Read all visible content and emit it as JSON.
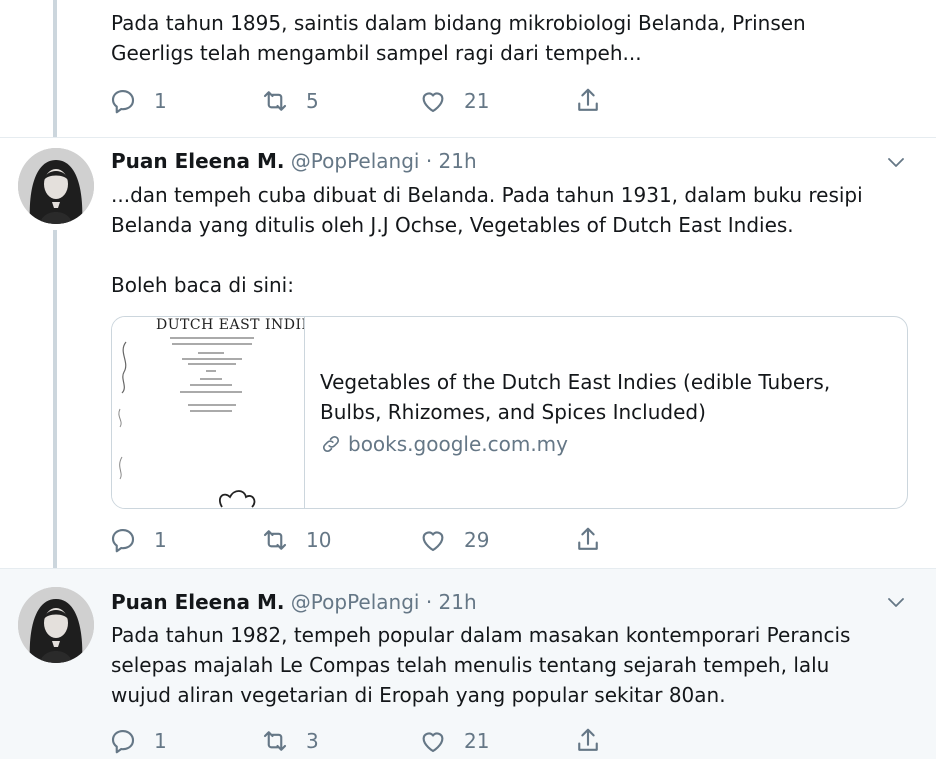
{
  "tweet_top": {
    "text": "Pada tahun 1895, saintis dalam bidang mikrobiologi Belanda, Prinsen\nGeerligs telah mengambil sampel ragi dari tempeh...",
    "reply_count": "1",
    "retweet_count": "5",
    "like_count": "21"
  },
  "tweet_middle": {
    "author_name": "Puan Eleena M.",
    "author_meta": "@PopPelangi · 21h",
    "text": "...dan tempeh cuba dibuat di Belanda. Pada tahun 1931, dalam buku resipi\nBelanda yang ditulis oleh J.J Ochse, Vegetables of Dutch East Indies.\n\nBoleh baca di sini:",
    "card": {
      "thumb_heading": "DUTCH EAST INDIE",
      "title": "Vegetables of the Dutch East Indies (edible Tubers, Bulbs, Rhizomes, and Spices Included)",
      "domain": "books.google.com.my"
    },
    "reply_count": "1",
    "retweet_count": "10",
    "like_count": "29"
  },
  "tweet_bottom": {
    "author_name": "Puan Eleena M.",
    "author_meta": "@PopPelangi · 21h",
    "text": "Pada tahun 1982, tempeh popular dalam masakan kontemporari Perancis\nselepas majalah Le Compas telah menulis tentang sejarah tempeh, lalu\nwujud aliran vegetarian di Eropah yang popular sekitar 80an.",
    "reply_count": "1",
    "retweet_count": "3",
    "like_count": "21"
  },
  "icons": [
    "reply-icon",
    "retweet-icon",
    "like-icon",
    "share-icon",
    "chevron-down-icon",
    "link-icon"
  ],
  "colors": {
    "text": "#14171a",
    "muted": "#657786",
    "border": "#ccd6dd",
    "highlight_bg": "#f5f8fa"
  }
}
